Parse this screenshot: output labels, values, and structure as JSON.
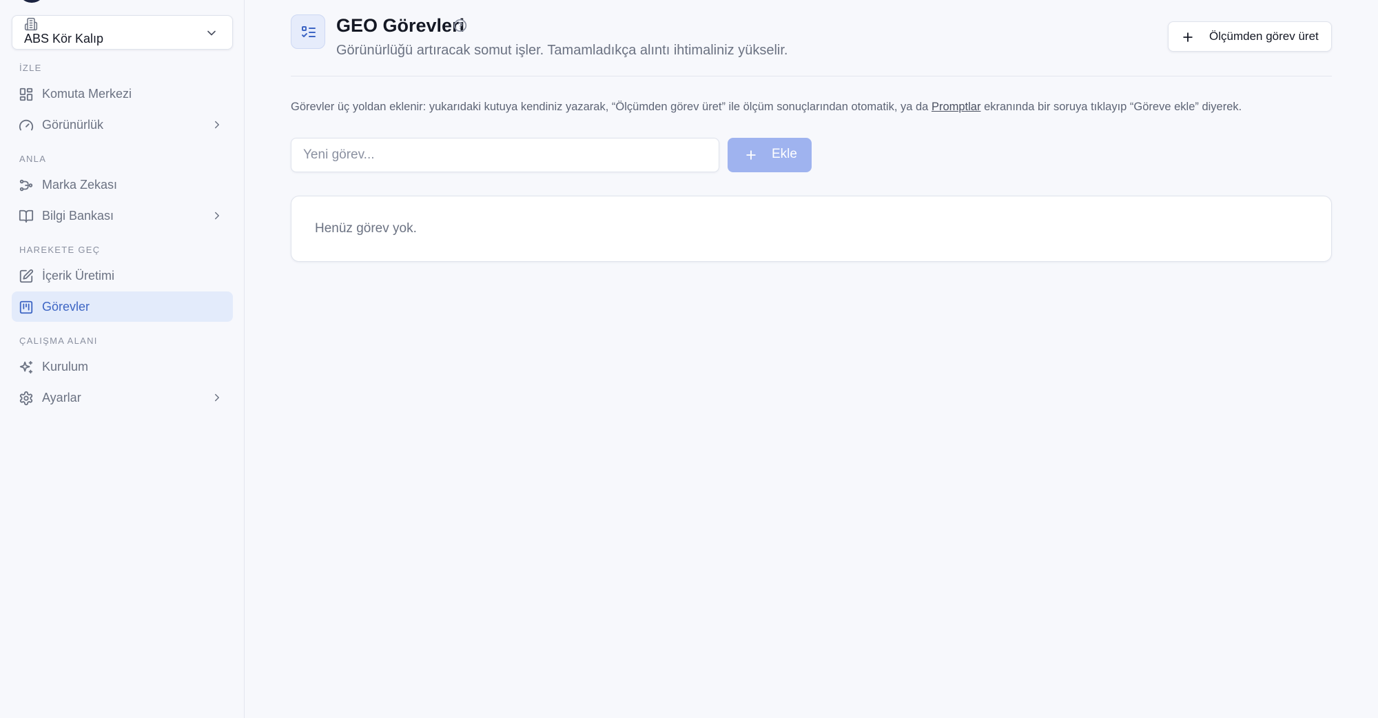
{
  "sidebar": {
    "workspace": {
      "name": "ABS Kör Kalıp"
    },
    "sections": [
      {
        "label": "İZLE"
      },
      {
        "label": "ANLA"
      },
      {
        "label": "HAREKETE GEÇ"
      },
      {
        "label": "ÇALIŞMA ALANI"
      }
    ],
    "items": [
      {
        "label": "Komuta Merkezi",
        "icon": "grid-icon",
        "has_submenu": false
      },
      {
        "label": "Görünürlük",
        "icon": "gauge-icon",
        "has_submenu": true
      },
      {
        "label": "Marka Zekası",
        "icon": "nodes-icon",
        "has_submenu": false
      },
      {
        "label": "Bilgi Bankası",
        "icon": "book-icon",
        "has_submenu": true
      },
      {
        "label": "İçerik Üretimi",
        "icon": "edit-icon",
        "has_submenu": false
      },
      {
        "label": "Görevler",
        "icon": "kanban-icon",
        "has_submenu": false,
        "active": true
      },
      {
        "label": "Kurulum",
        "icon": "sparkles-icon",
        "has_submenu": false
      },
      {
        "label": "Ayarlar",
        "icon": "gear-icon",
        "has_submenu": true
      }
    ]
  },
  "header": {
    "title": "GEO Görevleri",
    "subtitle": "Görünürlüğü artıracak somut işler. Tamamladıkça alıntı ihtimaliniz yükselir.",
    "generate_button": "Ölçümden görev üret"
  },
  "info": {
    "before_link": "Görevler üç yoldan eklenir: yukarıdaki kutuya kendiniz yazarak, “Ölçümden görev üret” ile ölçüm sonuçlarından otomatik, ya da ",
    "link": "Promptlar",
    "after_link": " ekranında bir soruya tıklayıp “Göreve ekle” diyerek."
  },
  "task_form": {
    "placeholder": "Yeni görev...",
    "value": "",
    "add_button": "Ekle"
  },
  "task_list": {
    "empty_text": "Henüz görev yok."
  },
  "colors": {
    "accent": "#3d65c4",
    "active_bg": "#e3ebfb",
    "add_button_bg": "#9fb3ef",
    "background": "#f7f8fc"
  }
}
